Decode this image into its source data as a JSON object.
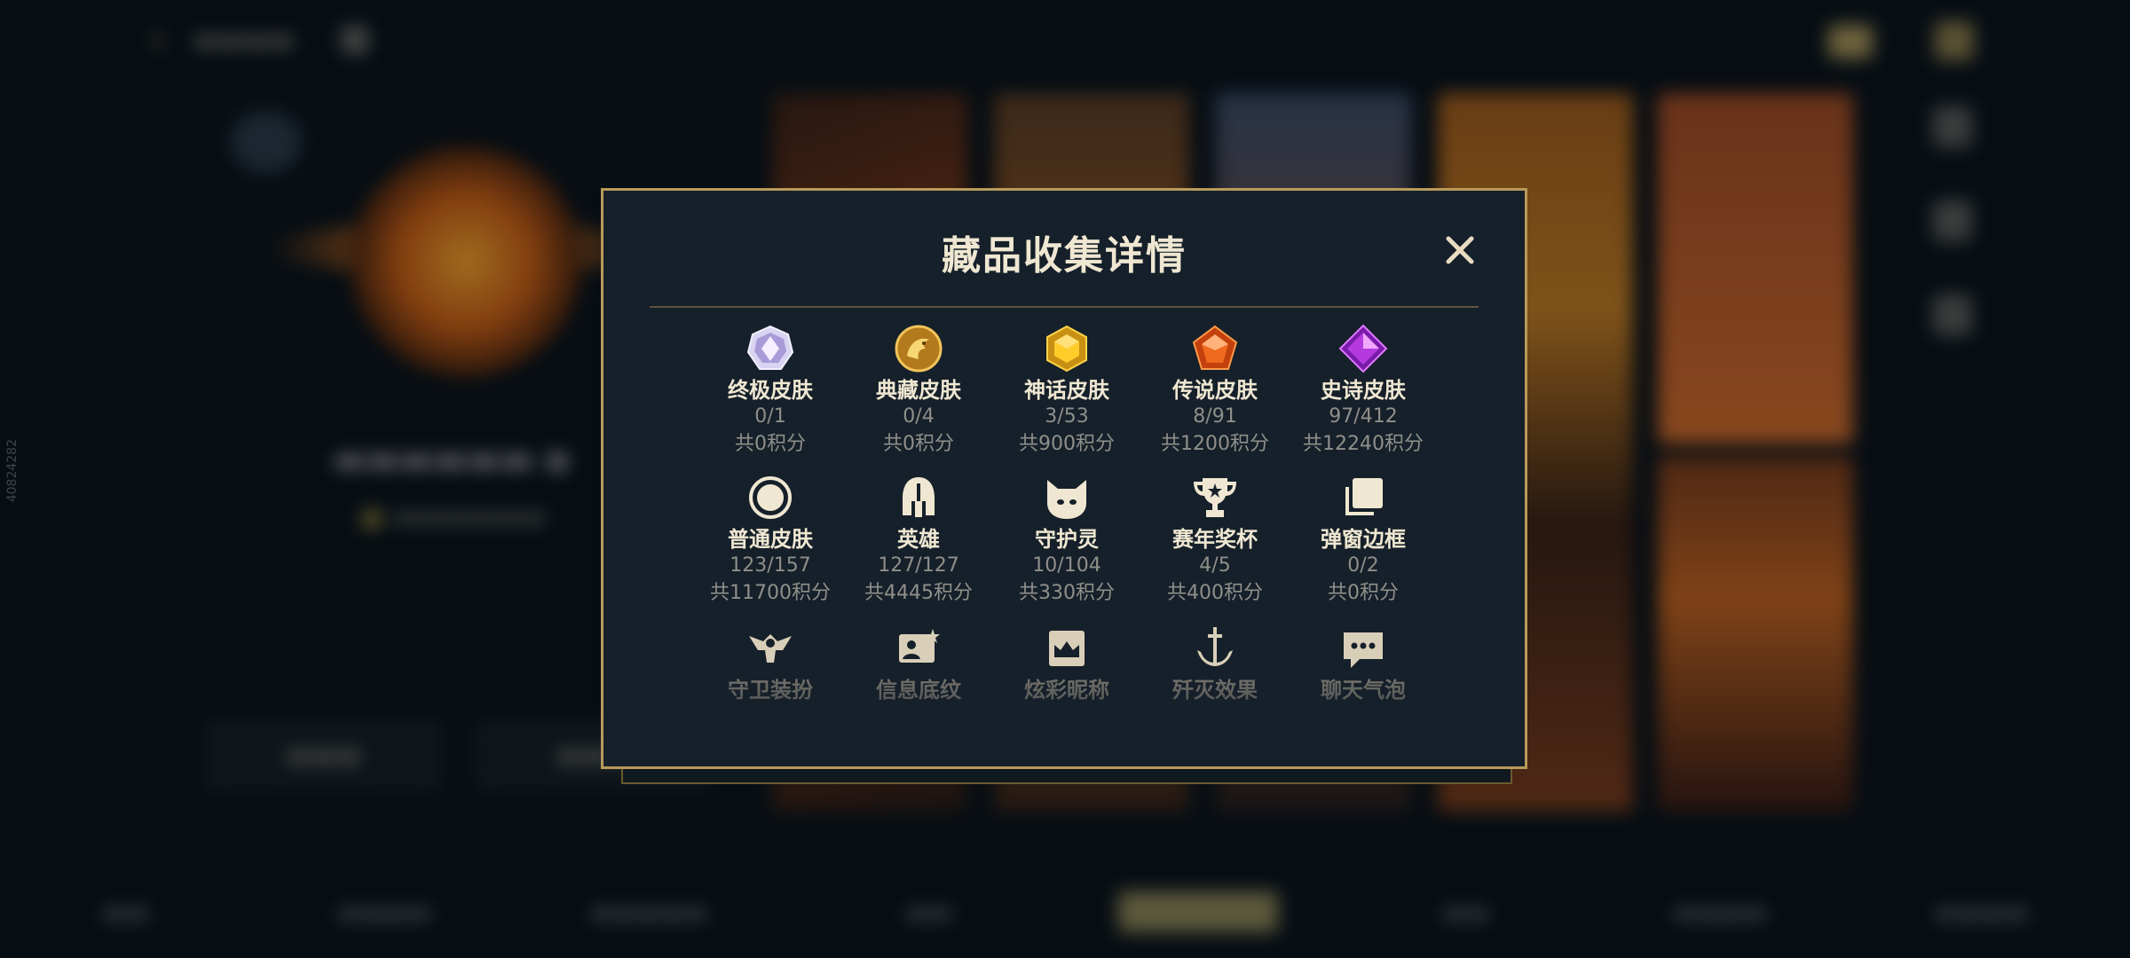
{
  "modal": {
    "title": "藏品收集详情",
    "close_icon": "close-icon",
    "accent_color": "#b99a5a",
    "categories": [
      {
        "icon": "ultimate-skin-gem-icon",
        "name": "终极皮肤",
        "count": "0/1",
        "points": "共0积分"
      },
      {
        "icon": "collector-skin-dragon-icon",
        "name": "典藏皮肤",
        "count": "0/4",
        "points": "共0积分"
      },
      {
        "icon": "mythic-skin-gem-icon",
        "name": "神话皮肤",
        "count": "3/53",
        "points": "共900积分"
      },
      {
        "icon": "legendary-skin-gem-icon",
        "name": "传说皮肤",
        "count": "8/91",
        "points": "共1200积分"
      },
      {
        "icon": "epic-skin-gem-icon",
        "name": "史诗皮肤",
        "count": "97/412",
        "points": "共12240积分"
      },
      {
        "icon": "normal-skin-ring-icon",
        "name": "普通皮肤",
        "count": "123/157",
        "points": "共11700积分"
      },
      {
        "icon": "champion-helmet-icon",
        "name": "英雄",
        "count": "127/127",
        "points": "共4445积分"
      },
      {
        "icon": "guardian-pet-icon",
        "name": "守护灵",
        "count": "10/104",
        "points": "共330积分"
      },
      {
        "icon": "season-trophy-icon",
        "name": "赛年奖杯",
        "count": "4/5",
        "points": "共400积分"
      },
      {
        "icon": "popup-frame-icon",
        "name": "弹窗边框",
        "count": "0/2",
        "points": "共0积分"
      },
      {
        "icon": "guard-outfit-icon",
        "name": "守卫装扮",
        "count": "",
        "points": ""
      },
      {
        "icon": "info-background-icon",
        "name": "信息底纹",
        "count": "",
        "points": ""
      },
      {
        "icon": "colorful-nickname-icon",
        "name": "炫彩昵称",
        "count": "",
        "points": ""
      },
      {
        "icon": "annihilation-effect-icon",
        "name": "歼灭效果",
        "count": "",
        "points": ""
      },
      {
        "icon": "chat-bubble-icon",
        "name": "聊天气泡",
        "count": "",
        "points": ""
      }
    ]
  },
  "background": {
    "side_id": "40824282"
  }
}
